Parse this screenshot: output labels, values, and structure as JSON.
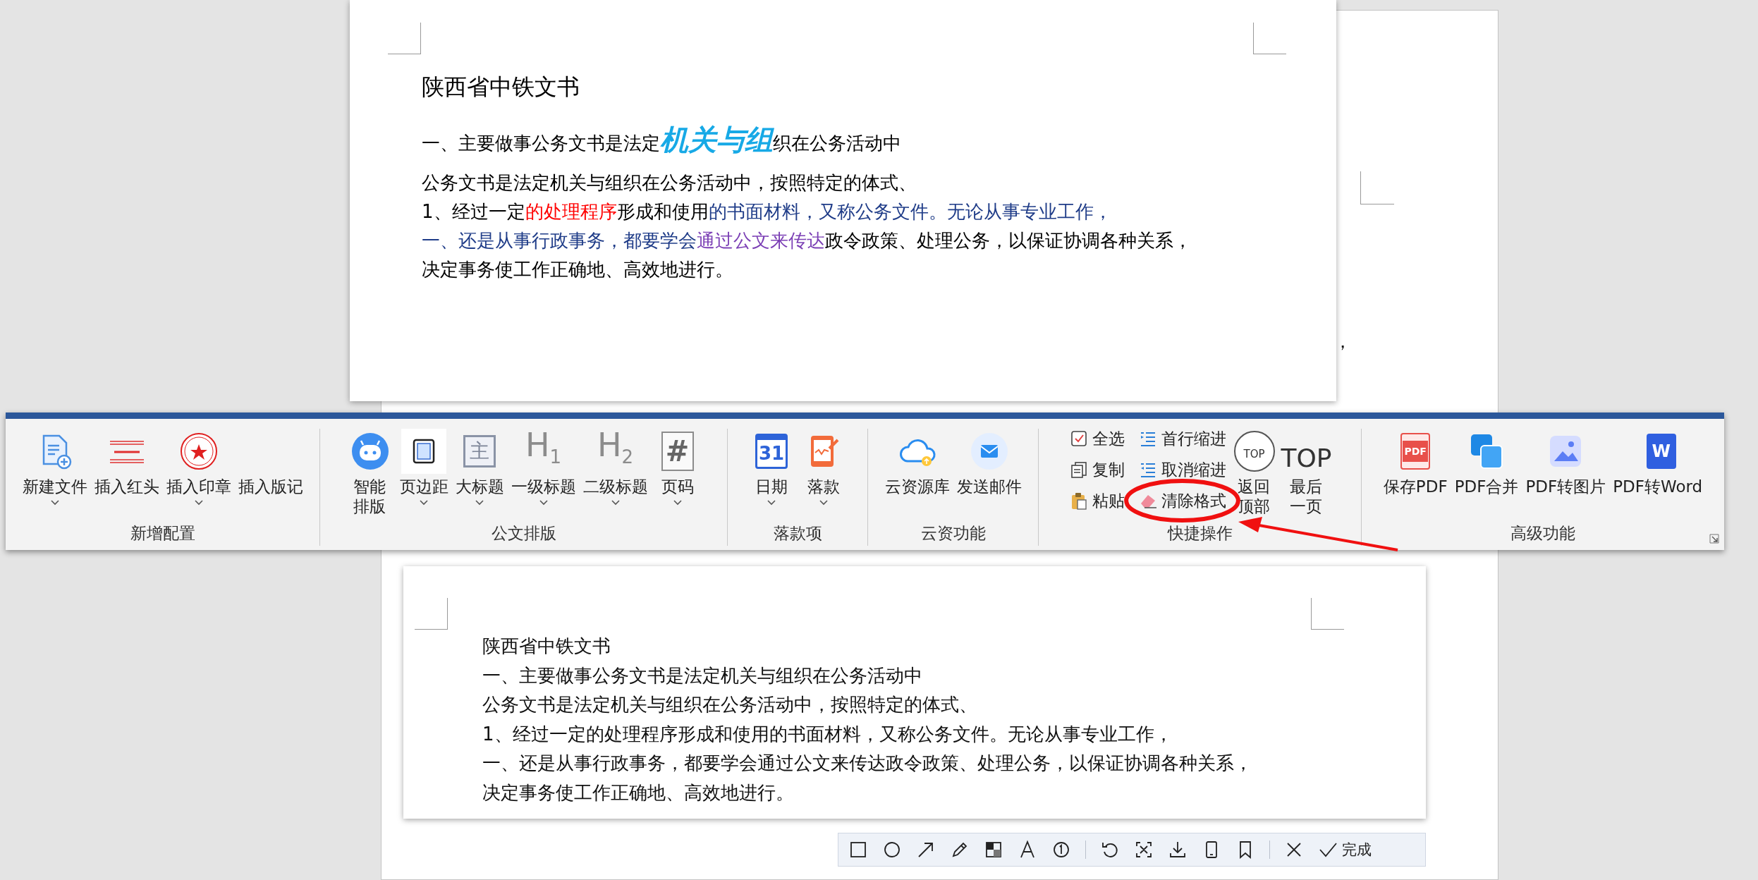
{
  "background_page": {
    "text_fragment": "，"
  },
  "top_document": {
    "lines": [
      {
        "kind": "title",
        "segments": [
          {
            "text": "陕西省中铁文书",
            "color": "#000000",
            "emphasis": false
          }
        ]
      },
      {
        "kind": "body",
        "segments": [
          {
            "text": "一、主要做事公务文书是法定",
            "color": "#000000",
            "emphasis": false
          },
          {
            "text": "机关与组",
            "color": "#17a9e6",
            "emphasis": true
          },
          {
            "text": "织在公务活动中",
            "color": "#000000",
            "emphasis": false
          }
        ]
      },
      {
        "kind": "body",
        "segments": [
          {
            "text": "公务文书是法定机关与组织在公务活动中，按照特定的体式、",
            "color": "#000000",
            "emphasis": false
          }
        ]
      },
      {
        "kind": "body",
        "segments": [
          {
            "text": "1、经过一定",
            "color": "#000000",
            "emphasis": false
          },
          {
            "text": "的处理程序",
            "color": "#ff0000",
            "emphasis": false
          },
          {
            "text": "形成和使用",
            "color": "#000000",
            "emphasis": false
          },
          {
            "text": "的书面材料，又称公务文件。无论从事专业工作，",
            "color": "#1f3c88",
            "emphasis": false
          }
        ]
      },
      {
        "kind": "body",
        "segments": [
          {
            "text": "一、还是从事行政事务，都要学会",
            "color": "#1f3c88",
            "emphasis": false
          },
          {
            "text": "通过公文来传达",
            "color": "#7b3fb5",
            "emphasis": false
          },
          {
            "text": "政令政策、处理公务，以保证协调各种关系，",
            "color": "#000000",
            "emphasis": false
          }
        ]
      },
      {
        "kind": "body",
        "segments": [
          {
            "text": "决定事务使工作正确地、高效地进行。",
            "color": "#000000",
            "emphasis": false
          }
        ]
      }
    ]
  },
  "ribbon": {
    "groups": [
      {
        "label": "新增配置",
        "items": [
          {
            "label": "新建文件",
            "dropdown": true,
            "highlighted": false
          },
          {
            "label": "插入红头",
            "dropdown": false,
            "highlighted": false
          },
          {
            "label": "插入印章",
            "dropdown": true,
            "highlighted": false
          },
          {
            "label": "插入版记",
            "dropdown": false,
            "highlighted": false
          }
        ]
      },
      {
        "label": "公文排版",
        "items": [
          {
            "label": "智能排版",
            "stacked": true,
            "dropdown": false,
            "highlighted": false
          },
          {
            "label": "页边距",
            "dropdown": true,
            "highlighted": true
          },
          {
            "label": "大标题",
            "icon_text": "主",
            "dropdown": true,
            "highlighted": false
          },
          {
            "label": "一级标题",
            "icon_text": "H$_{1}$",
            "dropdown": true,
            "highlighted": false
          },
          {
            "label": "二级标题",
            "icon_text": "H$_{2}$",
            "dropdown": true,
            "highlighted": false
          },
          {
            "label": "页码",
            "icon_text": "#",
            "dropdown": true,
            "highlighted": false
          }
        ]
      },
      {
        "label": "落款项",
        "items": [
          {
            "label": "日期",
            "icon_text": "31",
            "dropdown": true,
            "highlighted": false
          },
          {
            "label": "落款",
            "dropdown": true,
            "highlighted": false
          }
        ]
      },
      {
        "label": "云资功能",
        "items": [
          {
            "label": "云资源库",
            "dropdown": false,
            "highlighted": false
          },
          {
            "label": "发送邮件",
            "dropdown": false,
            "highlighted": false
          }
        ]
      },
      {
        "label": "快捷操作",
        "small_items": [
          {
            "label": "全选"
          },
          {
            "label": "复制"
          },
          {
            "label": "粘贴"
          },
          {
            "label": "首行缩进"
          },
          {
            "label": "取消缩进"
          },
          {
            "label": "清除格式"
          }
        ],
        "items": [
          {
            "label": "返回顶部",
            "stacked": true,
            "icon_text": "TOP",
            "dropdown": false,
            "highlighted": false
          },
          {
            "label": "最后一页",
            "stacked": true,
            "icon_text": "TOP",
            "dropdown": false,
            "highlighted": false
          }
        ]
      },
      {
        "label": "高级功能",
        "items": [
          {
            "label": "保存PDF",
            "icon_text": "PDF",
            "dropdown": false,
            "highlighted": false
          },
          {
            "label": "PDF合并",
            "dropdown": false,
            "highlighted": false
          },
          {
            "label": "PDF转图片",
            "dropdown": false,
            "highlighted": false
          },
          {
            "label": "PDF转Word",
            "icon_text": "W",
            "dropdown": false,
            "highlighted": false
          }
        ]
      }
    ]
  },
  "bottom_document": {
    "lines": [
      "陕西省中铁文书",
      "一、主要做事公务文书是法定机关与组织在公务活动中",
      "公务文书是法定机关与组织在公务活动中，按照特定的体式、",
      "1、经过一定的处理程序形成和使用的书面材料，又称公务文件。无论从事专业工作，",
      "一、还是从事行政事务，都要学会通过公文来传达政令政策、处理公务，以保证协调各种关系，",
      "决定事务使工作正确地、高效地进行。"
    ]
  },
  "annotation_toolbar": {
    "done_label": "完成"
  }
}
